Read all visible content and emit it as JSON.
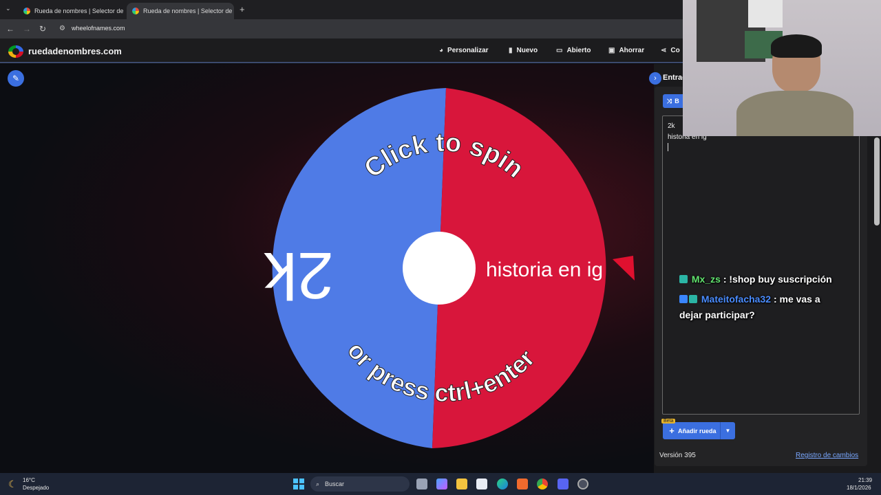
{
  "browser": {
    "tabs": [
      {
        "title": "Rueda de nombres | Selector de"
      },
      {
        "title": "Rueda de nombres | Selector de"
      }
    ],
    "new_tab": "+",
    "url": "wheelofnames.com"
  },
  "site": {
    "brand": "ruedadenombres.com",
    "nav": [
      {
        "label": "Personalizar",
        "icon": "palette-icon"
      },
      {
        "label": "Nuevo",
        "icon": "file-icon"
      },
      {
        "label": "Abierto",
        "icon": "folder-icon"
      },
      {
        "label": "Ahorrar",
        "icon": "save-icon"
      },
      {
        "label": "Co",
        "icon": "share-icon"
      }
    ]
  },
  "wheel": {
    "segments": [
      {
        "label": "2k",
        "color": "#4f7be6"
      },
      {
        "label": "historia en ig",
        "color": "#d8163b"
      }
    ],
    "top_text": "Click to spin",
    "bottom_text": "or press ctrl+enter"
  },
  "panel": {
    "header": "Entrad",
    "shuffle_label": "B",
    "entries": [
      "2k",
      "historia en ig"
    ],
    "add_wheel": "Añadir rueda",
    "beta": "Beta",
    "version": "Versión 395",
    "changelog": "Registro de cambios"
  },
  "chat": [
    {
      "user": "Mx_zs",
      "message": ": !shop buy suscripción"
    },
    {
      "user": "Mateitofacha32",
      "message": ": me vas a",
      "message2": "dejar participar?"
    }
  ],
  "taskbar": {
    "weather_temp": "16°C",
    "weather_desc": "Despejado",
    "search": "Buscar",
    "time": "21:39",
    "date": "18/1/2026"
  },
  "colors": {
    "accent": "#3b6fe0",
    "red": "#d8163b",
    "blue": "#4f7be6"
  }
}
